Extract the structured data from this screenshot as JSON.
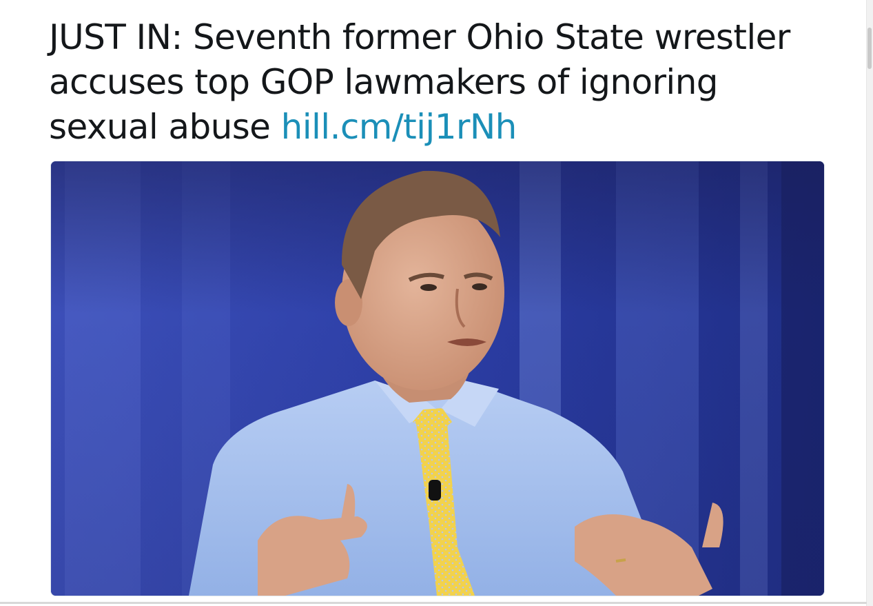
{
  "tweet": {
    "text": "JUST IN: Seventh former Ohio State wrestler accuses top GOP lawmakers of ignoring sexual abuse ",
    "link_text": "hill.cm/tij1rNh"
  },
  "media": {
    "alt": "Photo of a man in a light blue shirt and yellow patterned tie speaking and gesturing with both hands in front of a blue background"
  },
  "colors": {
    "link": "#1b8fb8",
    "text": "#14171a",
    "background_blue": "#2a3aa0",
    "shirt": "#a9c3ef",
    "tie": "#f1d24a"
  }
}
